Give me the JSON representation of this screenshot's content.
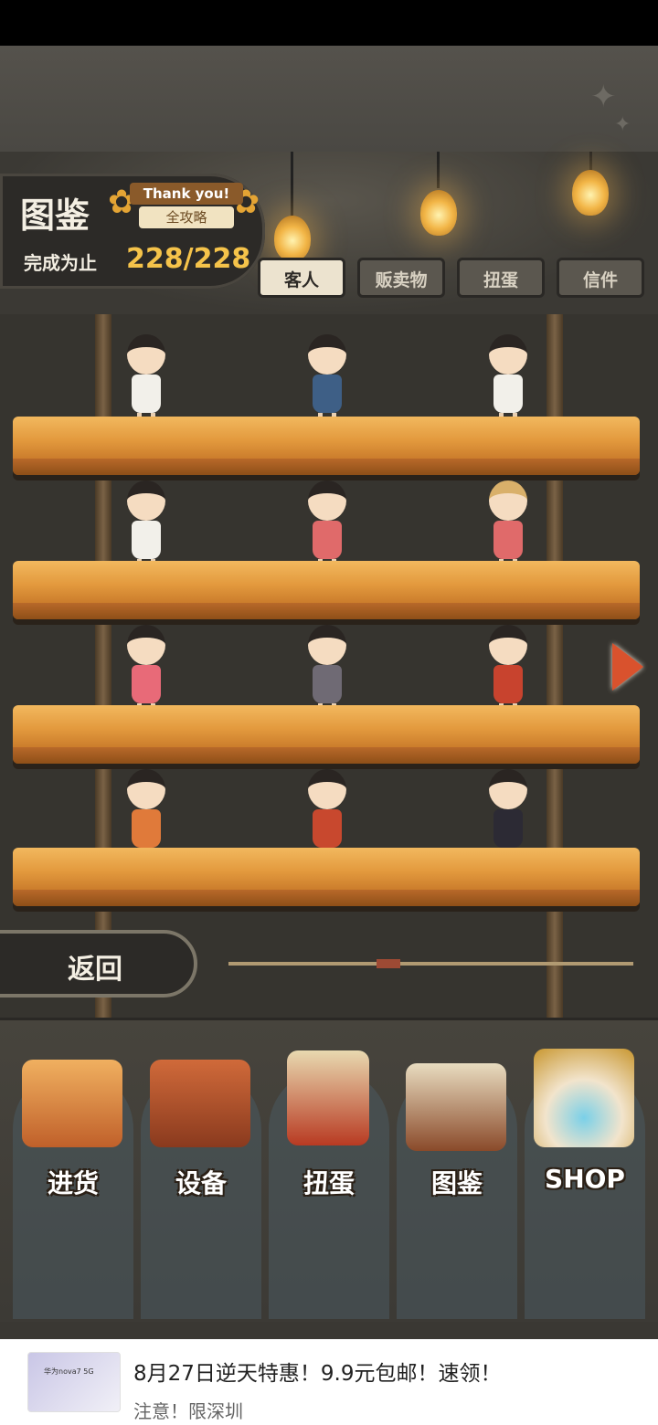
{
  "header": {
    "title": "图鉴",
    "award_line1": "Thank you!",
    "award_line2": "全攻略",
    "progress_label": "完成为止",
    "progress_value": "228/228"
  },
  "tabs": [
    {
      "label": "客人",
      "active": true
    },
    {
      "label": "贩卖物",
      "active": false
    },
    {
      "label": "扭蛋",
      "active": false
    },
    {
      "label": "信件",
      "active": false
    }
  ],
  "back_button": {
    "label": "返回"
  },
  "bottom_nav": [
    {
      "label": "进货",
      "icon": "crate-icon"
    },
    {
      "label": "设备",
      "icon": "toolbox-icon"
    },
    {
      "label": "扭蛋",
      "icon": "gacha-machine-icon"
    },
    {
      "label": "图鉴",
      "icon": "book-icon"
    },
    {
      "label": "SHOP",
      "icon": "lucky-cat-icon"
    }
  ],
  "ad": {
    "thumb_text": "华为nova7 5G",
    "title": "8月27日逆天特惠！9.9元包邮！速领！",
    "subtitle": "注意！限深圳"
  },
  "colors": {
    "accent_gold": "#f5c34a",
    "shelf_wood": "#e39a3e",
    "next_arrow": "#d9522d"
  }
}
